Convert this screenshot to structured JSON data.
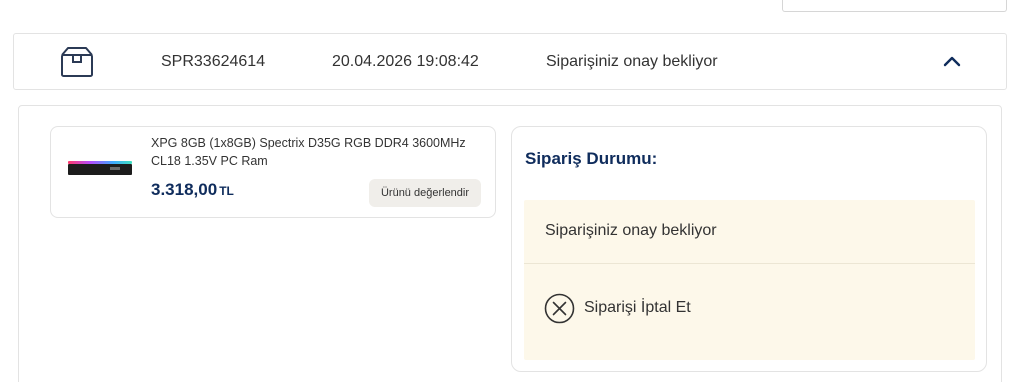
{
  "order": {
    "number": "SPR33624614",
    "date": "20.04.2026 19:08:42",
    "status": "Siparişiniz onay bekliyor"
  },
  "product": {
    "name": "XPG 8GB (1x8GB) Spectrix D35G RGB DDR4 3600MHz CL18 1.35V PC Ram",
    "price": "3.318,00",
    "currency": "TL",
    "rate_button": "Ürünü değerlendir",
    "image_icon": "ram-module-image"
  },
  "status_section": {
    "title": "Sipariş Durumu:",
    "status_text": "Siparişiniz onay bekliyor",
    "cancel_label": "Siparişi İptal Et",
    "cancel_icon": "close-circle-icon"
  },
  "icons": {
    "order_box": "package-icon",
    "collapse": "chevron-up-icon"
  },
  "colors": {
    "brand_navy": "#0f2c5c",
    "status_panel_bg": "#fdf8ea",
    "button_bg": "#f0eeea"
  }
}
